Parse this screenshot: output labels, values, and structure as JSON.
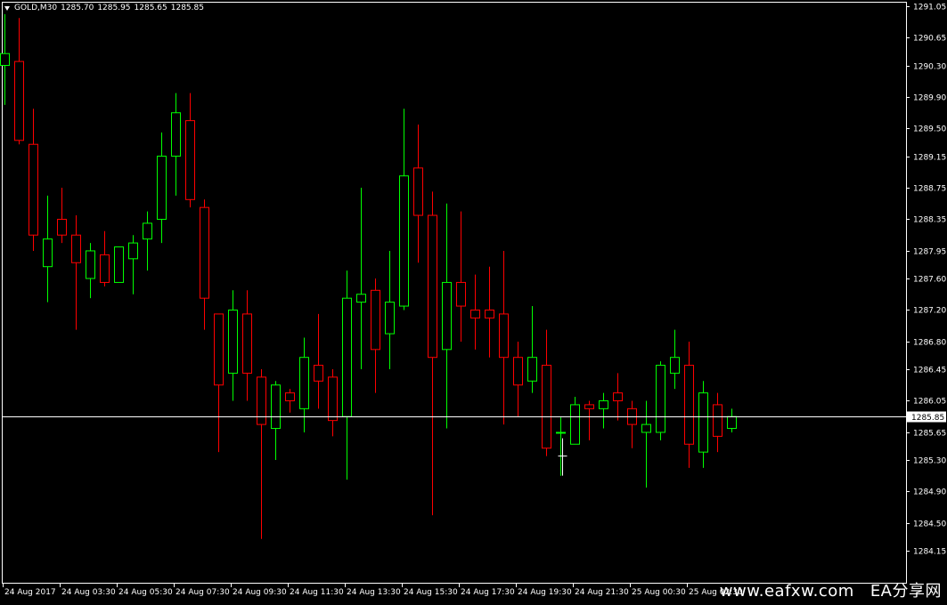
{
  "header": {
    "symbol_period": "GOLD,M30",
    "open": "1285.70",
    "high": "1285.95",
    "low": "1285.65",
    "close": "1285.85"
  },
  "watermark": {
    "site": "www.eafxw.com",
    "brand": "EA分享网"
  },
  "colors": {
    "background": "#000000",
    "bull": "#00ff00",
    "bear": "#ff0000",
    "axis": "#ffffff",
    "price_line": "#ffffff"
  },
  "chart_data": {
    "type": "candlestick",
    "symbol": "GOLD",
    "timeframe": "M30",
    "ylim": [
      1284.0,
      1291.15
    ],
    "y_ticks": [
      "1291.05",
      "1290.65",
      "1290.30",
      "1289.90",
      "1289.50",
      "1289.15",
      "1288.75",
      "1288.35",
      "1287.95",
      "1287.60",
      "1287.20",
      "1286.80",
      "1286.45",
      "1286.05",
      "1285.65",
      "1285.30",
      "1284.90",
      "1284.50",
      "1284.15"
    ],
    "x_tick_labels": [
      "24 Aug 2017",
      "24 Aug 03:30",
      "24 Aug 05:30",
      "24 Aug 07:30",
      "24 Aug 09:30",
      "24 Aug 11:30",
      "24 Aug 13:30",
      "24 Aug 15:30",
      "24 Aug 17:30",
      "24 Aug 19:30",
      "24 Aug 21:30",
      "25 Aug 00:30",
      "25 Aug 02:30"
    ],
    "current_price": "1285.85",
    "grid": false,
    "ohlc": [
      {
        "o": 1290.3,
        "h": 1290.95,
        "l": 1289.8,
        "c": 1290.45
      },
      {
        "o": 1290.35,
        "h": 1290.9,
        "l": 1289.3,
        "c": 1289.35
      },
      {
        "o": 1289.3,
        "h": 1289.75,
        "l": 1287.95,
        "c": 1288.15
      },
      {
        "o": 1287.75,
        "h": 1288.65,
        "l": 1287.3,
        "c": 1288.1
      },
      {
        "o": 1288.35,
        "h": 1288.75,
        "l": 1288.05,
        "c": 1288.15
      },
      {
        "o": 1288.15,
        "h": 1288.4,
        "l": 1286.95,
        "c": 1287.8
      },
      {
        "o": 1287.6,
        "h": 1288.05,
        "l": 1287.35,
        "c": 1287.95
      },
      {
        "o": 1287.9,
        "h": 1288.2,
        "l": 1287.5,
        "c": 1287.55
      },
      {
        "o": 1287.55,
        "h": 1288.0,
        "l": 1287.55,
        "c": 1288.0
      },
      {
        "o": 1287.85,
        "h": 1288.15,
        "l": 1287.4,
        "c": 1288.05
      },
      {
        "o": 1288.1,
        "h": 1288.45,
        "l": 1287.7,
        "c": 1288.3
      },
      {
        "o": 1288.35,
        "h": 1289.45,
        "l": 1288.05,
        "c": 1289.15
      },
      {
        "o": 1289.15,
        "h": 1289.95,
        "l": 1288.65,
        "c": 1289.7
      },
      {
        "o": 1289.6,
        "h": 1289.95,
        "l": 1288.5,
        "c": 1288.6
      },
      {
        "o": 1288.5,
        "h": 1288.6,
        "l": 1286.95,
        "c": 1287.35
      },
      {
        "o": 1287.15,
        "h": 1287.15,
        "l": 1285.4,
        "c": 1286.25
      },
      {
        "o": 1286.4,
        "h": 1287.45,
        "l": 1286.05,
        "c": 1287.2
      },
      {
        "o": 1287.15,
        "h": 1287.45,
        "l": 1286.05,
        "c": 1286.4
      },
      {
        "o": 1286.35,
        "h": 1286.45,
        "l": 1284.3,
        "c": 1285.75
      },
      {
        "o": 1285.7,
        "h": 1286.3,
        "l": 1285.3,
        "c": 1286.25
      },
      {
        "o": 1286.15,
        "h": 1286.2,
        "l": 1285.9,
        "c": 1286.05
      },
      {
        "o": 1285.95,
        "h": 1286.85,
        "l": 1285.65,
        "c": 1286.6
      },
      {
        "o": 1286.5,
        "h": 1287.15,
        "l": 1285.95,
        "c": 1286.3
      },
      {
        "o": 1286.35,
        "h": 1286.45,
        "l": 1285.6,
        "c": 1285.8
      },
      {
        "o": 1285.85,
        "h": 1287.7,
        "l": 1285.05,
        "c": 1287.35
      },
      {
        "o": 1287.3,
        "h": 1288.75,
        "l": 1286.45,
        "c": 1287.4
      },
      {
        "o": 1287.45,
        "h": 1287.6,
        "l": 1286.15,
        "c": 1286.7
      },
      {
        "o": 1286.9,
        "h": 1287.95,
        "l": 1286.45,
        "c": 1287.3
      },
      {
        "o": 1287.25,
        "h": 1289.75,
        "l": 1287.2,
        "c": 1288.9
      },
      {
        "o": 1289.0,
        "h": 1289.55,
        "l": 1287.8,
        "c": 1288.4
      },
      {
        "o": 1288.4,
        "h": 1288.7,
        "l": 1284.6,
        "c": 1286.6
      },
      {
        "o": 1286.7,
        "h": 1288.55,
        "l": 1285.7,
        "c": 1287.55
      },
      {
        "o": 1287.55,
        "h": 1288.45,
        "l": 1286.8,
        "c": 1287.25
      },
      {
        "o": 1287.2,
        "h": 1287.65,
        "l": 1286.7,
        "c": 1287.1
      },
      {
        "o": 1287.2,
        "h": 1287.75,
        "l": 1286.6,
        "c": 1287.1
      },
      {
        "o": 1287.15,
        "h": 1287.95,
        "l": 1285.75,
        "c": 1286.6
      },
      {
        "o": 1286.6,
        "h": 1286.8,
        "l": 1285.85,
        "c": 1286.25
      },
      {
        "o": 1286.3,
        "h": 1287.25,
        "l": 1286.15,
        "c": 1286.6
      },
      {
        "o": 1286.5,
        "h": 1286.95,
        "l": 1285.35,
        "c": 1285.45
      },
      {
        "o": 1285.65,
        "h": 1285.85,
        "l": 1285.1,
        "c": 1285.65
      },
      {
        "o": 1285.5,
        "h": 1286.1,
        "l": 1285.5,
        "c": 1286.0
      },
      {
        "o": 1286.0,
        "h": 1286.05,
        "l": 1285.55,
        "c": 1285.95
      },
      {
        "o": 1285.95,
        "h": 1286.15,
        "l": 1285.7,
        "c": 1286.05
      },
      {
        "o": 1286.15,
        "h": 1286.4,
        "l": 1285.8,
        "c": 1286.05
      },
      {
        "o": 1285.95,
        "h": 1286.05,
        "l": 1285.45,
        "c": 1285.75
      },
      {
        "o": 1285.65,
        "h": 1286.05,
        "l": 1284.95,
        "c": 1285.75
      },
      {
        "o": 1285.65,
        "h": 1286.55,
        "l": 1285.55,
        "c": 1286.5
      },
      {
        "o": 1286.4,
        "h": 1286.95,
        "l": 1286.2,
        "c": 1286.6
      },
      {
        "o": 1286.5,
        "h": 1286.8,
        "l": 1285.2,
        "c": 1285.5
      },
      {
        "o": 1285.4,
        "h": 1286.3,
        "l": 1285.2,
        "c": 1286.15
      },
      {
        "o": 1286.0,
        "h": 1286.15,
        "l": 1285.4,
        "c": 1285.6
      },
      {
        "o": 1285.7,
        "h": 1285.95,
        "l": 1285.65,
        "c": 1285.85
      }
    ]
  }
}
